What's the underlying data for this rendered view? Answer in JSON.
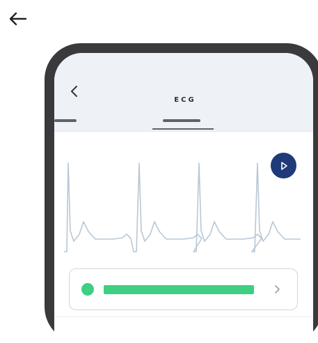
{
  "page": {
    "back_icon": "arrow-left-icon"
  },
  "screen": {
    "title": "ECG",
    "back_icon": "chevron-left-icon",
    "play_icon": "play-icon"
  },
  "summary": {
    "status_color": "#3ecf82",
    "chevron_icon": "chevron-right-icon"
  },
  "colors": {
    "frame": "#3a3a3c",
    "header_bg": "#eef2f7",
    "play_button": "#1f3a78",
    "waveform": "#b9c7d4",
    "status": "#3ecf82"
  }
}
